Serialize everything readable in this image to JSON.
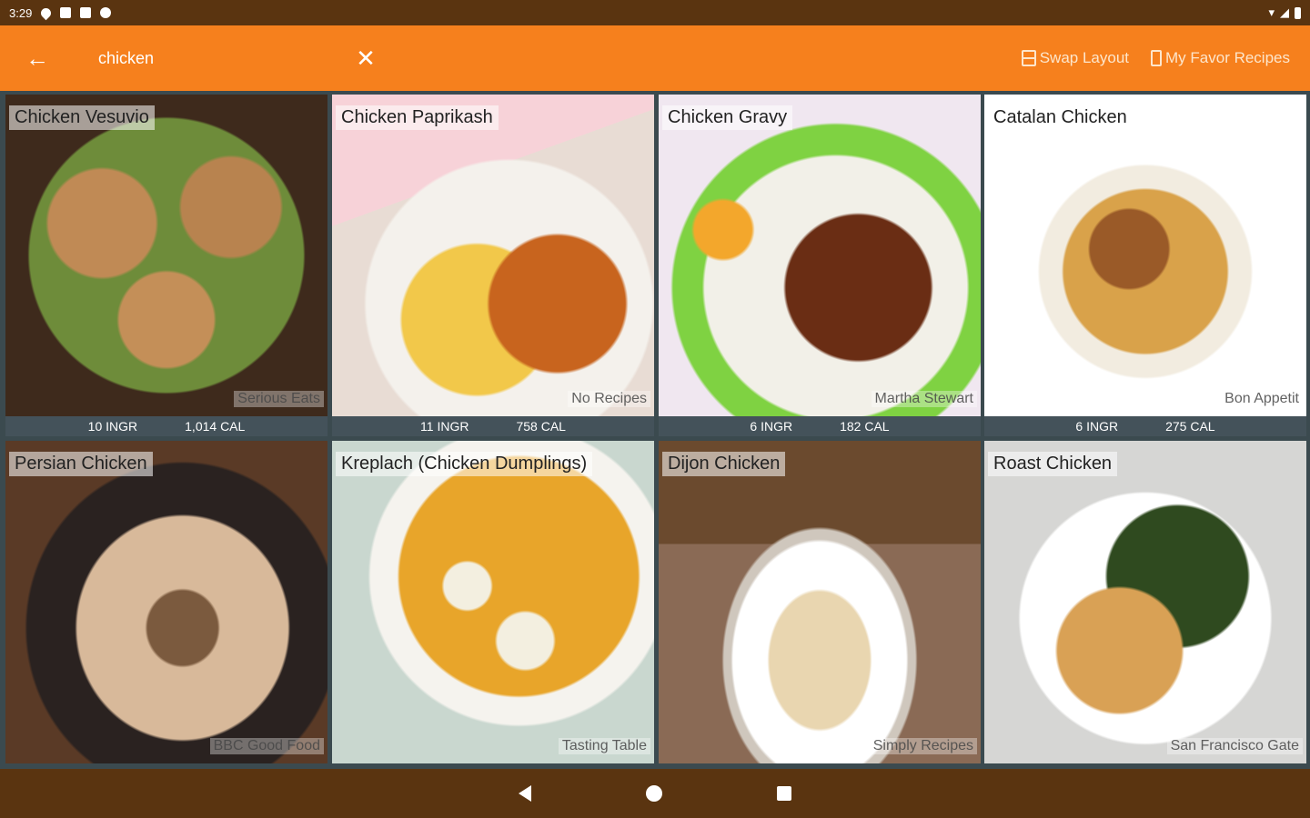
{
  "status_bar": {
    "time": "3:29"
  },
  "app_bar": {
    "search_value": "chicken",
    "actions": {
      "swap_layout": "Swap Layout",
      "my_favor_recipes": "My Favor Recipes"
    }
  },
  "recipes": [
    {
      "title": "Chicken Vesuvio",
      "source": "Serious Eats",
      "ingr": "10 INGR",
      "cal": "1,014 CAL"
    },
    {
      "title": "Chicken Paprikash",
      "source": "No Recipes",
      "ingr": "11 INGR",
      "cal": "758 CAL"
    },
    {
      "title": "Chicken Gravy",
      "source": "Martha Stewart",
      "ingr": "6 INGR",
      "cal": "182 CAL"
    },
    {
      "title": "Catalan Chicken",
      "source": "Bon Appetit",
      "ingr": "6 INGR",
      "cal": "275 CAL"
    },
    {
      "title": "Persian Chicken",
      "source": "BBC Good Food"
    },
    {
      "title": "Kreplach (Chicken Dumplings)",
      "source": "Tasting Table"
    },
    {
      "title": "Dijon Chicken",
      "source": "Simply Recipes"
    },
    {
      "title": "Roast Chicken",
      "source": "San Francisco Gate"
    }
  ],
  "colors": {
    "app_bar": "#f6801d",
    "system_bars": "#5a3410",
    "stats_bar": "#44525a"
  }
}
